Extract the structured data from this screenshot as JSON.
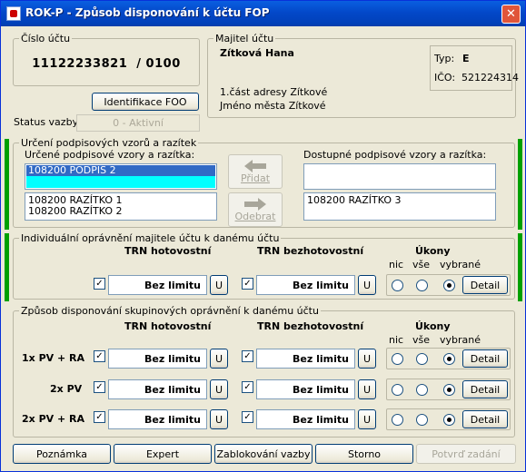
{
  "window": {
    "title": "ROK-P - Způsob disponování k účtu  FOP",
    "close": "✕"
  },
  "cislo_uctu": {
    "label": "Číslo účtu",
    "value": "11122233821  / 0100"
  },
  "majitel": {
    "label": "Majitel účtu",
    "name": "Zítková Hana",
    "address1": "1.část adresy Zítkové",
    "address2": "Jméno města Zítkové",
    "typ_label": "Typ:",
    "typ_value": "E",
    "ico_label": "IČO:",
    "ico_value": "521224314"
  },
  "identifikace_button": "Identifikace FOO",
  "status": {
    "label": "Status vazby",
    "value": "0 - Aktivní"
  },
  "podpisy": {
    "label": "Určení podpisových vzorů a razítek",
    "assigned_label": "Určené podpisové vzory a  razítka:",
    "assigned_list1": [
      "108200 PODPIS 2"
    ],
    "assigned_list2": [
      "108200 RAZÍTKO 1",
      "108200 RAZÍTKO 2"
    ],
    "available_label": "Dostupné podpisové vzory a  razítka:",
    "available_list1": [],
    "available_list2": [
      "108200 RAZÍTKO 3"
    ],
    "add_button": "Přidat",
    "remove_button": "Odebrat"
  },
  "individual": {
    "label": "Individuální oprávnění majitele účtu k danému účtu",
    "trn_cash": "TRN hotovostní",
    "trn_noncash": "TRN bezhotovostní",
    "ukony": "Úkony",
    "nic": "nic",
    "vse": "vše",
    "vybrane": "vybrané",
    "row": {
      "cash_value": "Bez limitu",
      "noncash_value": "Bez limitu",
      "u": "U",
      "detail": "Detail",
      "cash_checked": true,
      "noncash_checked": true,
      "selected": "vybrané"
    }
  },
  "group": {
    "label": "Způsob disponování skupinových oprávnění k danému účtu",
    "trn_cash": "TRN hotovostní",
    "trn_noncash": "TRN bezhotovostní",
    "ukony": "Úkony",
    "nic": "nic",
    "vse": "vše",
    "vybrane": "vybrané",
    "rows": [
      {
        "name": "1x PV + RA",
        "cash_value": "Bez limitu",
        "noncash_value": "Bez limitu",
        "u": "U",
        "detail": "Detail",
        "cash_checked": true,
        "noncash_checked": true,
        "selected": "vybrané"
      },
      {
        "name": "2x PV",
        "cash_value": "Bez limitu",
        "noncash_value": "Bez limitu",
        "u": "U",
        "detail": "Detail",
        "cash_checked": true,
        "noncash_checked": true,
        "selected": "vybrané"
      },
      {
        "name": "2x PV + RA",
        "cash_value": "Bez limitu",
        "noncash_value": "Bez limitu",
        "u": "U",
        "detail": "Detail",
        "cash_checked": true,
        "noncash_checked": true,
        "selected": "vybrané"
      }
    ]
  },
  "footer": {
    "poznamka": "Poznámka",
    "expert": "Expert",
    "zablokovani": "Zablokování vazby",
    "storno": "Storno",
    "potvrd": "Potvrď zadání"
  },
  "colors": {
    "titlebar": "#0348c9",
    "selection": "#316ac5",
    "cyan": "#00ffff",
    "greenbar": "#00a000"
  },
  "icons": {
    "add": "arrow-left-icon",
    "remove": "arrow-right-icon",
    "app": "app-icon",
    "close": "close-icon"
  }
}
